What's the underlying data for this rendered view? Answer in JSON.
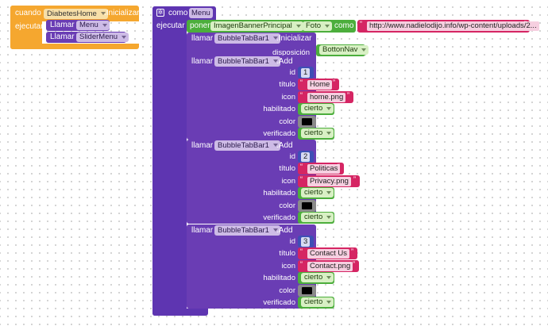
{
  "event": {
    "when": "cuando",
    "component": "DiabetesHome",
    "event_name": ".Inicializar",
    "do": "ejecutar",
    "calls": [
      {
        "keyword": "Llamar",
        "proc": "Menu"
      },
      {
        "keyword": "Llamar",
        "proc": "SliderMenu"
      }
    ]
  },
  "procedure": {
    "keyword": "como",
    "name": "Menu",
    "do": "ejecutar",
    "set": {
      "keyword": "poner",
      "component": "ImagenBannerPrincipal",
      "property": "Foto",
      "to": "como",
      "value": "http://www.nadielodijo.info/wp-content/uploads/2..."
    },
    "init": {
      "keyword": "llamar",
      "component": "BubbleTabBar1",
      "method": ".Inicializar",
      "param_label": "disposición",
      "param_value": "BottonNav"
    },
    "adds": [
      {
        "keyword": "llamar",
        "component": "BubbleTabBar1",
        "method": ".Add",
        "labels": {
          "id": "id",
          "title": "título",
          "icon": "icon",
          "enabled": "habilitado",
          "color": "color",
          "checked": "verificado"
        },
        "id": "1",
        "title": "Home",
        "icon": "home.png",
        "enabled": "cierto",
        "color": "#000000",
        "checked": "cierto"
      },
      {
        "keyword": "llamar",
        "component": "BubbleTabBar1",
        "method": ".Add",
        "labels": {
          "id": "id",
          "title": "título",
          "icon": "icon",
          "enabled": "habilitado",
          "color": "color",
          "checked": "verificado"
        },
        "id": "2",
        "title": "Politicas",
        "icon": "Privacy.png",
        "enabled": "cierto",
        "color": "#000000",
        "checked": "cierto"
      },
      {
        "keyword": "llamar",
        "component": "BubbleTabBar1",
        "method": ".Add",
        "labels": {
          "id": "id",
          "title": "título",
          "icon": "icon",
          "enabled": "habilitado",
          "color": "color",
          "checked": "verificado"
        },
        "id": "3",
        "title": "Contact Us",
        "icon": "Contact.png",
        "enabled": "cierto",
        "color": "#000000",
        "checked": "cierto"
      }
    ]
  },
  "colors": {
    "event": "#f5a72f",
    "procedure": "#5e35b1",
    "component_call": "#6a3db4",
    "logic": "#4cae3c",
    "text": "#d52563",
    "math": "#3e4fb5",
    "color_block": "#8a8a8a"
  }
}
